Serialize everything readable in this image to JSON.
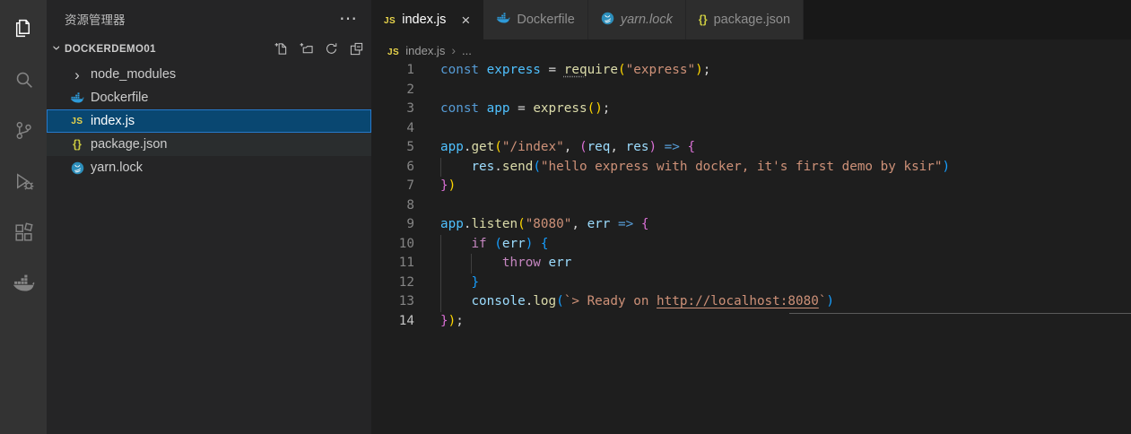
{
  "colors": {
    "activity_bg": "#333333",
    "sidebar_bg": "#252526",
    "editor_bg": "#1e1e1e",
    "tabstrip_bg": "#181818",
    "tab_inactive_bg": "#2d2d2d",
    "tab_active_bg": "#1e1e1e",
    "selection_bg": "#094771",
    "selection_border": "#2679ca",
    "hover_bg": "#2a2d2e"
  },
  "syntax": {
    "kw": "#569cd6",
    "ctrl": "#c586c0",
    "fn": "#dcdcaa",
    "str": "#ce9178",
    "var": "#9cdcfe",
    "cvar": "#4fc1ff",
    "pun": "#d4d4d4",
    "b1": "#ffd700",
    "b2": "#da70d6",
    "b3": "#179fff",
    "ln": "#858585",
    "ln_active": "#c6c6c6",
    "guide": "#404040"
  },
  "activity_bar": {
    "items": [
      {
        "name": "explorer",
        "icon": "files",
        "active": true
      },
      {
        "name": "search",
        "icon": "search",
        "active": false
      },
      {
        "name": "source-control",
        "icon": "source-control",
        "active": false
      },
      {
        "name": "run-debug",
        "icon": "debug",
        "active": false
      },
      {
        "name": "extensions",
        "icon": "extensions",
        "active": false
      },
      {
        "name": "docker",
        "icon": "docker",
        "active": false
      }
    ]
  },
  "sidebar": {
    "title": "资源管理器",
    "more_label": "⋯",
    "section": {
      "label": "DOCKERDEMO01",
      "actions": [
        {
          "name": "new-file",
          "icon": "new-file"
        },
        {
          "name": "new-folder",
          "icon": "new-folder"
        },
        {
          "name": "refresh",
          "icon": "refresh"
        },
        {
          "name": "collapse-all",
          "icon": "collapse-all"
        }
      ]
    },
    "files": [
      {
        "label": "node_modules",
        "icon": "chevron-right",
        "kind": "folder"
      },
      {
        "label": "Dockerfile",
        "icon": "docker-file"
      },
      {
        "label": "index.js",
        "icon": "js-badge",
        "selected": true
      },
      {
        "label": "package.json",
        "icon": "json-braces",
        "hover": true
      },
      {
        "label": "yarn.lock",
        "icon": "yarn"
      }
    ]
  },
  "tabs": [
    {
      "label": "index.js",
      "icon": "js-badge",
      "active": true,
      "close_label": "×"
    },
    {
      "label": "Dockerfile",
      "icon": "docker-file"
    },
    {
      "label": "yarn.lock",
      "icon": "yarn",
      "italic": true
    },
    {
      "label": "package.json",
      "icon": "json-braces"
    }
  ],
  "breadcrumb": {
    "icon": "js-badge",
    "file": "index.js",
    "separator": "›",
    "more": "..."
  },
  "editor": {
    "lines": [
      {
        "n": "1",
        "t": [
          [
            "const ",
            "kw"
          ],
          [
            "express ",
            "cvar"
          ],
          [
            "= ",
            "pun"
          ],
          [
            "req",
            "fn sq"
          ],
          [
            "uire",
            "fn"
          ],
          [
            "(",
            "b1"
          ],
          [
            "\"express\"",
            "str"
          ],
          [
            ")",
            "b1"
          ],
          [
            ";",
            "pun"
          ]
        ]
      },
      {
        "n": "2",
        "t": []
      },
      {
        "n": "3",
        "t": [
          [
            "const ",
            "kw"
          ],
          [
            "app ",
            "cvar"
          ],
          [
            "= ",
            "pun"
          ],
          [
            "express",
            "fn"
          ],
          [
            "(",
            "b1"
          ],
          [
            ")",
            "b1"
          ],
          [
            ";",
            "pun"
          ]
        ]
      },
      {
        "n": "4",
        "t": []
      },
      {
        "n": "5",
        "t": [
          [
            "app",
            "cvar"
          ],
          [
            ".",
            "pun"
          ],
          [
            "get",
            "fn"
          ],
          [
            "(",
            "b1"
          ],
          [
            "\"/index\"",
            "str"
          ],
          [
            ", ",
            "pun"
          ],
          [
            "(",
            "b2"
          ],
          [
            "req",
            "var"
          ],
          [
            ", ",
            "pun"
          ],
          [
            "res",
            "var"
          ],
          [
            ")",
            "b2"
          ],
          [
            " ",
            "pun"
          ],
          [
            "=>",
            "kw"
          ],
          [
            " ",
            "pun"
          ],
          [
            "{",
            "b2"
          ]
        ]
      },
      {
        "n": "6",
        "g": [
          0
        ],
        "t": [
          [
            "    ",
            "pun"
          ],
          [
            "res",
            "var"
          ],
          [
            ".",
            "pun"
          ],
          [
            "send",
            "fn"
          ],
          [
            "(",
            "b3"
          ],
          [
            "\"hello express with docker, it's first demo by ksir\"",
            "str"
          ],
          [
            ")",
            "b3"
          ]
        ]
      },
      {
        "n": "7",
        "t": [
          [
            "}",
            "b2"
          ],
          [
            ")",
            "b1"
          ]
        ]
      },
      {
        "n": "8",
        "t": []
      },
      {
        "n": "9",
        "t": [
          [
            "app",
            "cvar"
          ],
          [
            ".",
            "pun"
          ],
          [
            "listen",
            "fn"
          ],
          [
            "(",
            "b1"
          ],
          [
            "\"8080\"",
            "str"
          ],
          [
            ", ",
            "pun"
          ],
          [
            "err",
            "var"
          ],
          [
            " ",
            "pun"
          ],
          [
            "=>",
            "kw"
          ],
          [
            " ",
            "pun"
          ],
          [
            "{",
            "b2"
          ]
        ]
      },
      {
        "n": "10",
        "g": [
          0
        ],
        "t": [
          [
            "    ",
            "pun"
          ],
          [
            "if",
            "ctrl"
          ],
          [
            " ",
            "pun"
          ],
          [
            "(",
            "b3"
          ],
          [
            "err",
            "var"
          ],
          [
            ")",
            "b3"
          ],
          [
            " ",
            "pun"
          ],
          [
            "{",
            "b3"
          ]
        ]
      },
      {
        "n": "11",
        "g": [
          0,
          4
        ],
        "t": [
          [
            "        ",
            "pun"
          ],
          [
            "throw",
            "ctrl"
          ],
          [
            " ",
            "pun"
          ],
          [
            "err",
            "var"
          ]
        ]
      },
      {
        "n": "12",
        "g": [
          0
        ],
        "t": [
          [
            "    ",
            "pun"
          ],
          [
            "}",
            "b3"
          ]
        ]
      },
      {
        "n": "13",
        "g": [
          0
        ],
        "t": [
          [
            "    ",
            "pun"
          ],
          [
            "console",
            "var"
          ],
          [
            ".",
            "pun"
          ],
          [
            "log",
            "fn"
          ],
          [
            "(",
            "b3"
          ],
          [
            "`> Ready on ",
            "str"
          ],
          [
            "http://localhost:8080",
            "str link"
          ],
          [
            "`",
            "str"
          ],
          [
            ")",
            "b3"
          ]
        ]
      },
      {
        "n": "14",
        "active": true,
        "t": [
          [
            "}",
            "b2"
          ],
          [
            ")",
            "b1"
          ],
          [
            ";",
            "pun"
          ]
        ]
      }
    ]
  }
}
